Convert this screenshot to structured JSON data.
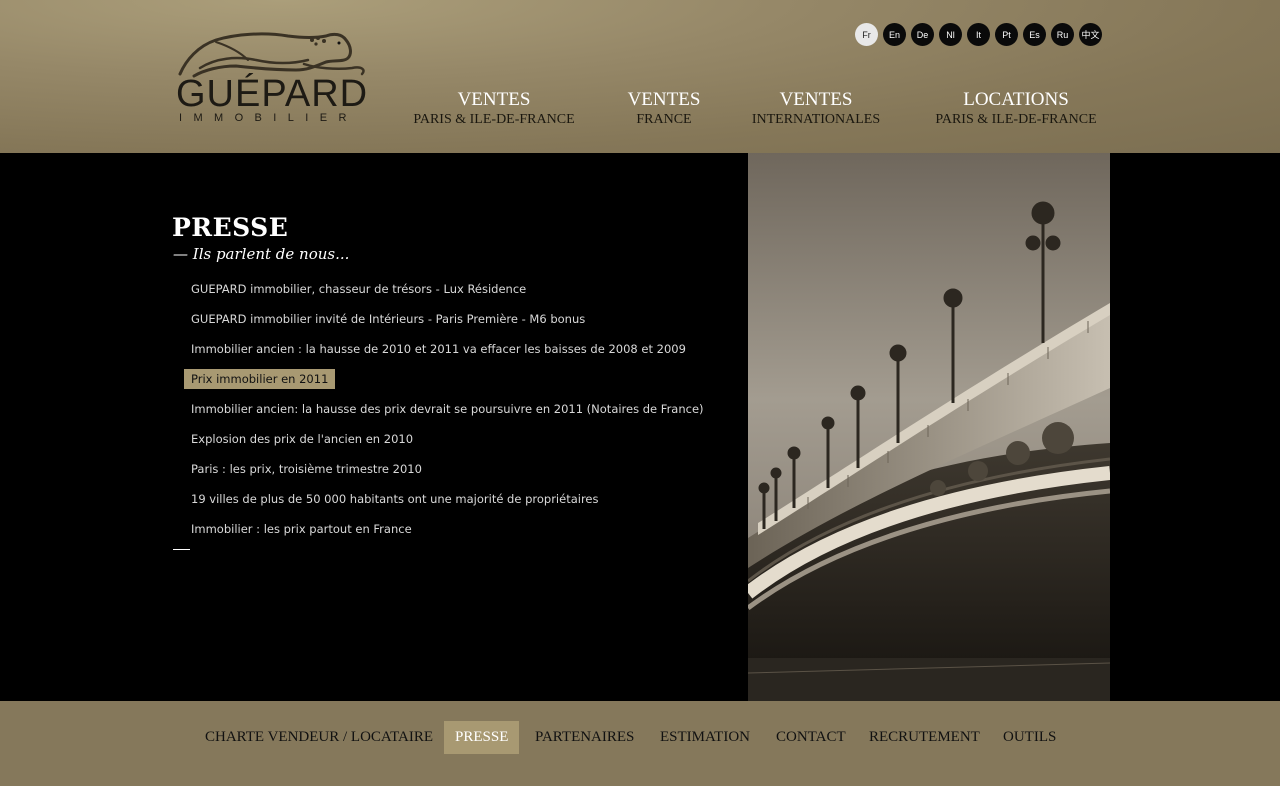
{
  "brand": {
    "name": "GUÉPARD",
    "subtitle": "IMMOBILIER"
  },
  "languages": [
    {
      "code": "Fr",
      "active": true
    },
    {
      "code": "En"
    },
    {
      "code": "De"
    },
    {
      "code": "Nl"
    },
    {
      "code": "It"
    },
    {
      "code": "Pt"
    },
    {
      "code": "Es"
    },
    {
      "code": "Ru"
    },
    {
      "code": "中文"
    }
  ],
  "main_nav": [
    {
      "title": "VENTES",
      "subtitle": "PARIS & ILE-DE-FRANCE"
    },
    {
      "title": "VENTES",
      "subtitle": "FRANCE"
    },
    {
      "title": "VENTES",
      "subtitle": "INTERNATIONALES"
    },
    {
      "title": "LOCATIONS",
      "subtitle": "PARIS & ILE-DE-FRANCE"
    }
  ],
  "page": {
    "title": "PRESSE",
    "subtitle": "— Ils parlent de nous...",
    "articles": [
      "GUEPARD immobilier, chasseur de trésors - Lux Résidence",
      "GUEPARD immobilier invité de Intérieurs - Paris Première - M6 bonus",
      "Immobilier ancien : la hausse de 2010 et 2011 va effacer les baisses de 2008 et 2009",
      "Prix immobilier en 2011",
      "Immobilier ancien: la hausse des prix devrait se poursuivre en 2011 (Notaires de France)",
      "Explosion des prix de l'ancien en 2010",
      "Paris : les prix, troisième trimestre 2010",
      "19 villes de plus de 50 000 habitants ont une majorité de propriétaires",
      "Immobilier : les prix partout en France"
    ],
    "active_article_index": 3
  },
  "footer_nav": [
    {
      "label": "CHARTE VENDEUR / LOCATAIRE"
    },
    {
      "label": "PRESSE",
      "active": true
    },
    {
      "label": "PARTENAIRES"
    },
    {
      "label": "ESTIMATION"
    },
    {
      "label": "CONTACT"
    },
    {
      "label": "RECRUTEMENT"
    },
    {
      "label": "OUTILS"
    }
  ],
  "colors": {
    "header_bg": "#968868",
    "footer_bg": "#85785b",
    "accent_highlight": "#a89972",
    "content_bg": "#000000"
  }
}
